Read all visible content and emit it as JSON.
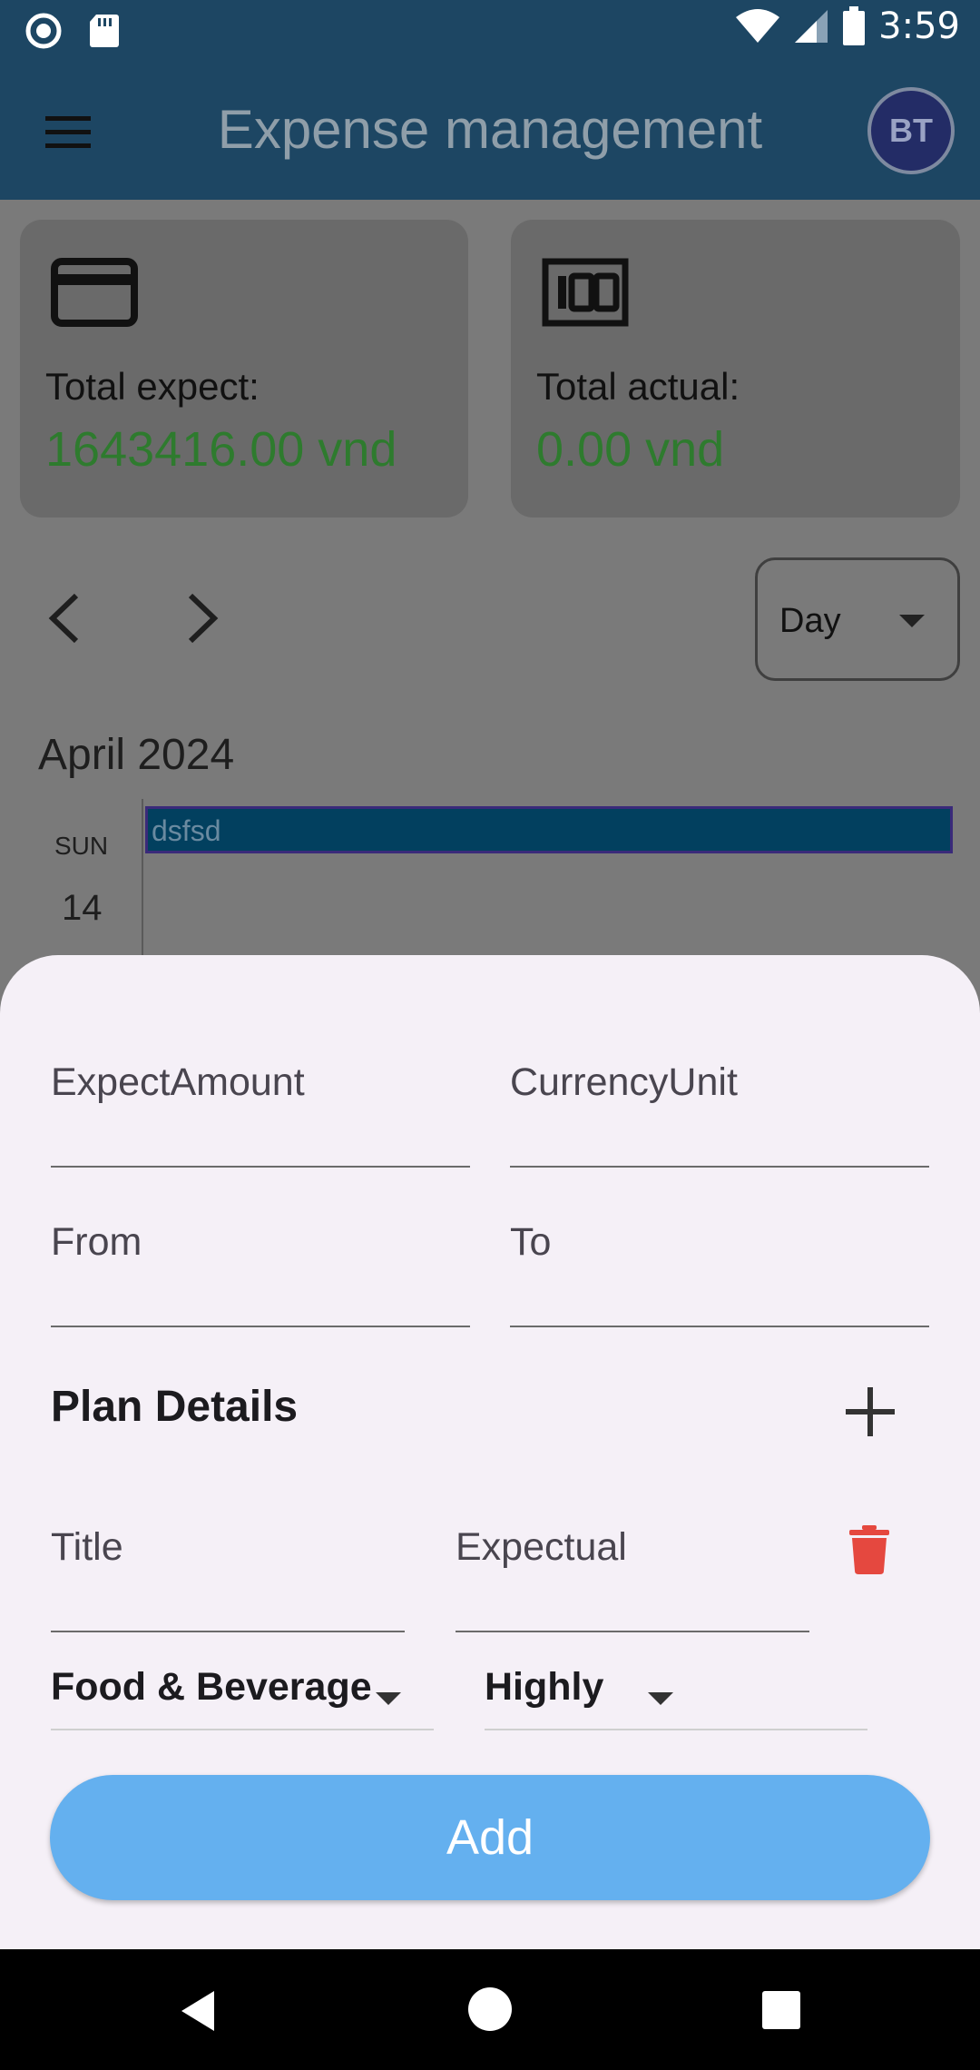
{
  "status_bar": {
    "time": "3:59"
  },
  "app_bar": {
    "title": "Expense management",
    "avatar_initials": "BT"
  },
  "summary": {
    "expect_label": "Total expect:",
    "expect_value": "1643416.00 vnd",
    "actual_label": "Total actual:",
    "actual_value": "0.00 vnd",
    "value_color": "#2e7b2e"
  },
  "calendar": {
    "view_mode": "Day",
    "month": "April 2024",
    "day_of_week": "SUN",
    "day_number": "14",
    "event_title": "dsfsd"
  },
  "form": {
    "expect_amount_label": "ExpectAmount",
    "currency_unit_label": "CurrencyUnit",
    "from_label": "From",
    "to_label": "To",
    "plan_details_title": "Plan Details",
    "detail_title_label": "Title",
    "detail_expectual_label": "Expectual",
    "category_value": "Food & Beverage",
    "priority_value": "Highly",
    "add_button_label": "Add",
    "add_button_color": "#64b0ef",
    "delete_icon_color": "#e5483f"
  },
  "icons": {
    "status_left": [
      "record-icon",
      "sd-card-icon"
    ],
    "status_right": [
      "wifi-icon",
      "signal-icon",
      "battery-icon"
    ],
    "summary_left": "credit-card-icon",
    "summary_right": "hundred-icon"
  }
}
